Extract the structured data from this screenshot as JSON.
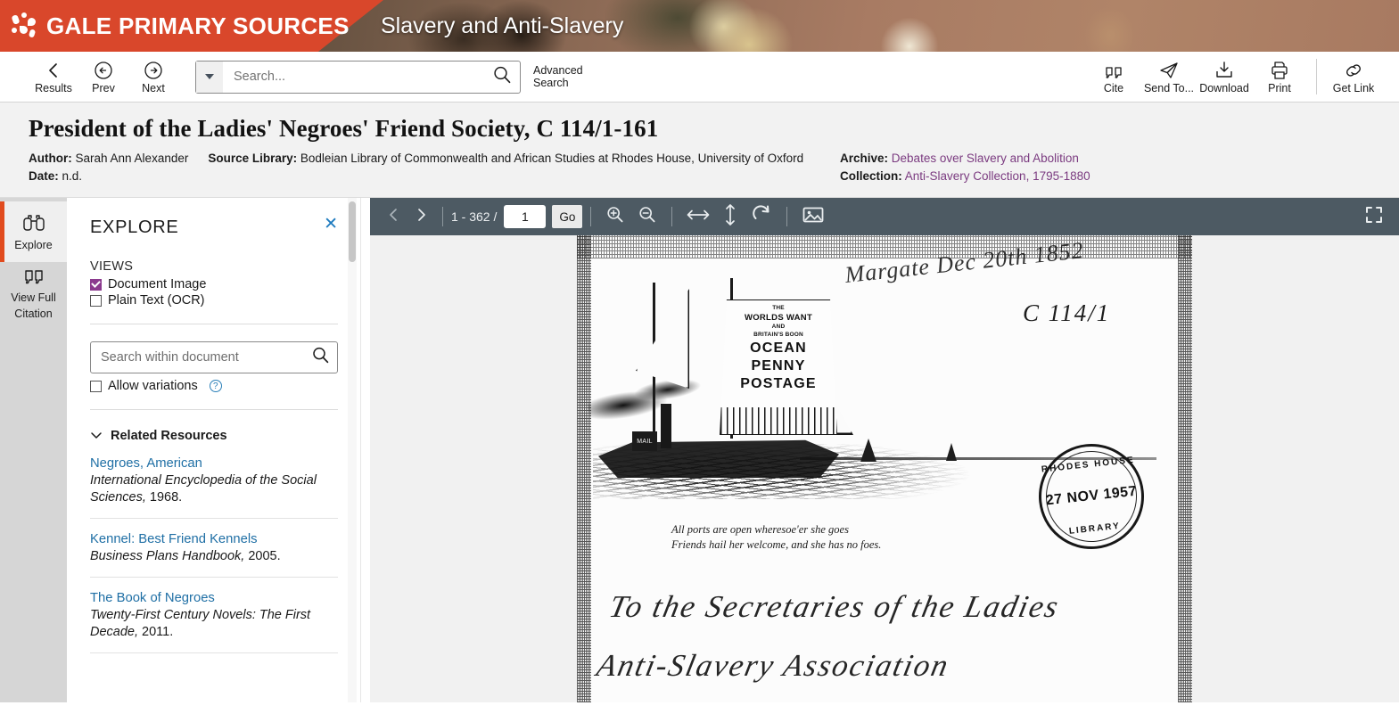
{
  "banner": {
    "brand": "GALE PRIMARY SOURCES",
    "product_title": "Slavery and Anti-Slavery",
    "brand_red": "#d9472b"
  },
  "toolbar": {
    "results": "Results",
    "prev": "Prev",
    "next": "Next",
    "search_placeholder": "Search...",
    "search_value": "",
    "advanced_search": "Advanced\nSearch",
    "advanced_search_line1": "Advanced",
    "advanced_search_line2": "Search",
    "cite": "Cite",
    "send_to": "Send To...",
    "download": "Download",
    "print": "Print",
    "get_link": "Get Link"
  },
  "document": {
    "title": "President of the Ladies' Negroes' Friend Society, C 114/1-161",
    "author_label": "Author:",
    "author": "Sarah Ann Alexander",
    "source_library_label": "Source Library:",
    "source_library": "Bodleian Library of Commonwealth and African Studies at Rhodes House, University of Oxford",
    "date_label": "Date:",
    "date": "n.d.",
    "archive_label": "Archive:",
    "archive": "Debates over Slavery and Abolition",
    "collection_label": "Collection:",
    "collection": "Anti-Slavery Collection, 1795-1880",
    "link_color": "#7b3b80"
  },
  "rail": {
    "items": [
      {
        "label": "Explore",
        "icon": "binoculars-icon",
        "active": true
      },
      {
        "label": "View Full\nCitation",
        "label_line1": "View Full",
        "label_line2": "Citation",
        "icon": "quote-icon",
        "active": false
      }
    ],
    "accent": "#e14b1e"
  },
  "explore": {
    "title": "EXPLORE",
    "close": "✕",
    "views_label": "VIEWS",
    "views": [
      {
        "label": "Document Image",
        "checked": true
      },
      {
        "label": "Plain Text (OCR)",
        "checked": false
      }
    ],
    "search_within_placeholder": "Search within document",
    "search_within_value": "",
    "allow_variations_label": "Allow variations",
    "allow_variations_checked": false,
    "help_glyph": "?",
    "related_resources_label": "Related Resources",
    "related_resources": [
      {
        "link": "Negroes, American",
        "source_italic": "International Encyclopedia of the Social Sciences,",
        "source_rest": " 1968."
      },
      {
        "link": "Kennel: Best Friend Kennels",
        "source_italic": "Business Plans Handbook,",
        "source_rest": " 2005."
      },
      {
        "link": "The Book of Negroes",
        "source_italic": "Twenty-First Century Novels: The First Decade,",
        "source_rest": " 2011."
      }
    ],
    "checkbox_color": "#8b3a8e",
    "link_color": "#1f6fa5"
  },
  "viewer": {
    "page_range": "1 - 362 /",
    "page_value": "1",
    "go_label": "Go",
    "toolbar_bg": "#4d5a63",
    "icons": {
      "prev": "chevron-left-icon",
      "next": "chevron-right-icon",
      "zoom_in": "zoom-in-icon",
      "zoom_out": "zoom-out-icon",
      "fit_width": "fit-width-icon",
      "fit_height": "fit-height-icon",
      "rotate": "rotate-icon",
      "image": "image-icon",
      "fullscreen": "fullscreen-icon"
    }
  },
  "facsimile": {
    "sail_line1": "THE",
    "sail_line2": "WORLDS WANT",
    "sail_line3": "AND",
    "sail_line4": "BRITAIN'S BOON",
    "sail_big1": "OCEAN",
    "sail_big2": "PENNY",
    "sail_big3": "POSTAGE",
    "flag_label": "MAIL",
    "motto_line1": "All ports are open wheresoe'er she goes",
    "motto_line2": "Friends hail her welcome, and she has no foes.",
    "handwriting_top": "Margate Dec 20th 1852",
    "reference_mark": "C 114/1",
    "address_line1": "To the Secretaries of the Ladies",
    "address_line2": "Anti-Slavery Association",
    "stamp_top": "RHODES HOUSE",
    "stamp_date": "27 NOV 1957",
    "stamp_bottom": "LIBRARY"
  }
}
